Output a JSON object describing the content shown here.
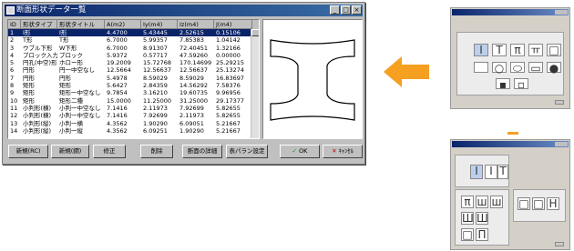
{
  "dialog": {
    "title": "断面形状データ一覧",
    "columns": [
      "ID",
      "形状タイプ",
      "形状タイトル",
      "A(m2)",
      "Iy(m4)",
      "Iz(m4)",
      "J(m4)"
    ],
    "rows": [
      [
        "1",
        "I形",
        "I形",
        "4.4700",
        "5.43445",
        "2.52615",
        "0.15106"
      ],
      [
        "2",
        "T形",
        "T形",
        "6.7000",
        "5.99357",
        "7.85383",
        "1.04142"
      ],
      [
        "3",
        "ウブル下形",
        "W下形",
        "6.7000",
        "8.91307",
        "72.40451",
        "1.32166"
      ],
      [
        "4",
        "ブロック入力",
        "ブロック",
        "5.9372",
        "0.57717",
        "47.59260",
        "0.00000"
      ],
      [
        "5",
        "円孔(中空)形",
        "ホロー形",
        "19.2009",
        "15.72768",
        "170.14699",
        "25.29215"
      ],
      [
        "6",
        "円形",
        "円一中空なし",
        "12.5664",
        "12.56637",
        "12.56637",
        "25.13274"
      ],
      [
        "7",
        "円形",
        "円形",
        "5.4978",
        "8.59029",
        "8.59029",
        "16.83697"
      ],
      [
        "8",
        "矩形",
        "矩形",
        "5.6427",
        "2.84359",
        "14.56292",
        "7.58376"
      ],
      [
        "9",
        "矩形",
        "矩形一中空なし",
        "9.7854",
        "3.16210",
        "19.60735",
        "9.96956"
      ],
      [
        "10",
        "矩形",
        "矩形二種",
        "15.0000",
        "11.25000",
        "31.25000",
        "29.17377"
      ],
      [
        "11",
        "小判形(横)",
        "小判一中空なし",
        "7.1416",
        "2.11973",
        "7.92699",
        "5.82655"
      ],
      [
        "12",
        "小判形(横)",
        "小判一中空なし",
        "7.1416",
        "7.92699",
        "2.11973",
        "5.82655"
      ],
      [
        "13",
        "小判形(縦)",
        "小判一横",
        "4.3562",
        "1.90290",
        "6.09051",
        "5.21667"
      ],
      [
        "14",
        "小判形(縦)",
        "小判一縦",
        "4.3562",
        "6.09251",
        "1.90290",
        "5.21667"
      ]
    ],
    "buttons": {
      "new_rc": "新規(RC)",
      "new_s": "新規(鋼)",
      "modify": "修正",
      "delete": "削除",
      "detail": "断面の詳細",
      "table_settings": "表パラン設定",
      "ok": "OK",
      "cancel": "ｷｬﾝｾﾙ"
    }
  },
  "icons": {
    "close": "×",
    "maximize": "□",
    "minimize": "_"
  },
  "accent_color": "#f5a020"
}
